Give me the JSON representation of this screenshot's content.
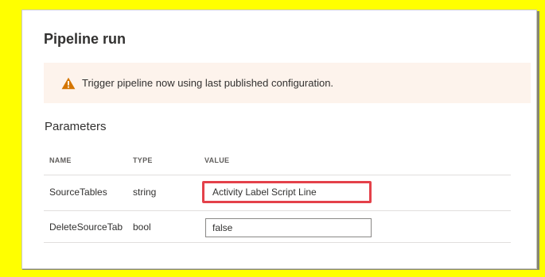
{
  "dialog": {
    "title": "Pipeline run",
    "banner_text": "Trigger pipeline now using last published configuration.",
    "banner_icon": "warning-icon",
    "section_label": "Parameters"
  },
  "table": {
    "headers": {
      "name": "NAME",
      "type": "TYPE",
      "value": "VALUE"
    },
    "rows": [
      {
        "name": "SourceTables",
        "type": "string",
        "value": "Activity Label Script Line"
      },
      {
        "name": "DeleteSourceTab",
        "type": "bool",
        "value": "false"
      }
    ]
  },
  "colors": {
    "background_highlight": "#ffff00",
    "warning": "#d47500",
    "annotation_box": "#e4414a"
  }
}
